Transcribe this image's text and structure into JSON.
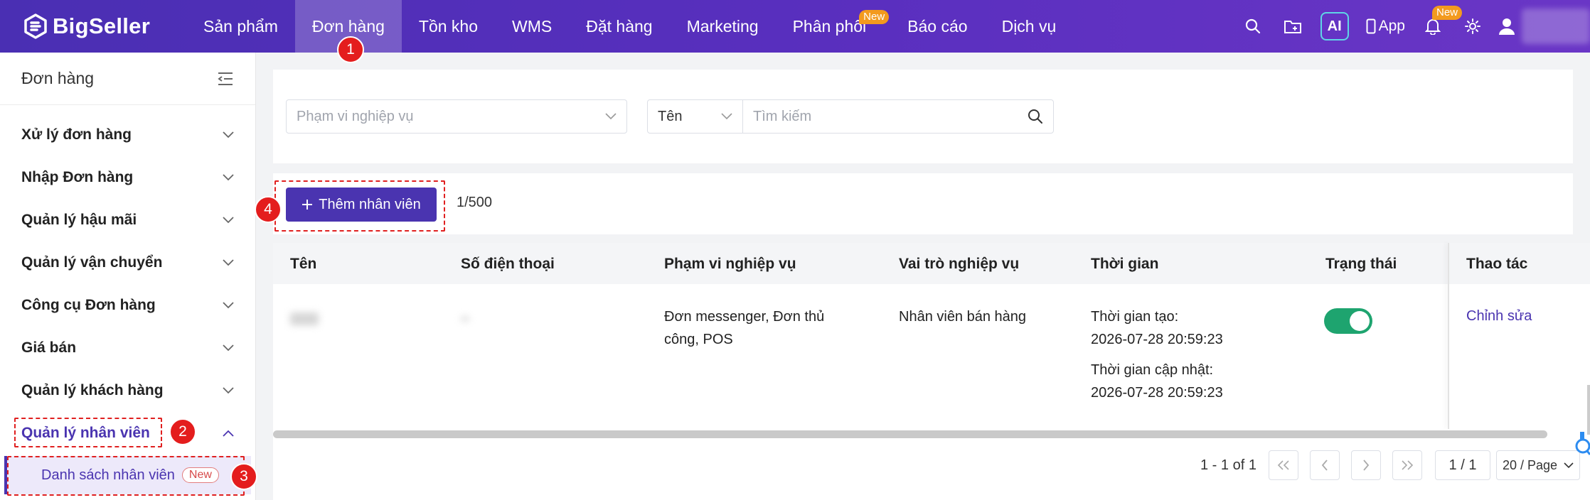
{
  "brand": {
    "name": "BigSeller"
  },
  "nav": {
    "items": [
      {
        "label": "Sản phẩm"
      },
      {
        "label": "Đơn hàng",
        "active": true
      },
      {
        "label": "Tồn kho"
      },
      {
        "label": "WMS"
      },
      {
        "label": "Đặt hàng"
      },
      {
        "label": "Marketing"
      },
      {
        "label": "Phân phối",
        "badge": "New"
      },
      {
        "label": "Báo cáo"
      },
      {
        "label": "Dịch vụ"
      }
    ],
    "right": {
      "ai_label": "AI",
      "app_label": "App",
      "bell_badge": "New"
    }
  },
  "sidebar": {
    "title": "Đơn hàng",
    "items": [
      {
        "label": "Xử lý đơn hàng"
      },
      {
        "label": "Nhập Đơn hàng"
      },
      {
        "label": "Quản lý hậu mãi"
      },
      {
        "label": "Quản lý vận chuyển"
      },
      {
        "label": "Công cụ Đơn hàng"
      },
      {
        "label": "Giá bán"
      },
      {
        "label": "Quản lý khách hàng"
      },
      {
        "label": "Quản lý nhân viên",
        "open": true
      }
    ],
    "sub_item": {
      "label": "Danh sách nhân viên",
      "badge": "New"
    }
  },
  "filters": {
    "scope_placeholder": "Phạm vi nghiệp vụ",
    "search_field": "Tên",
    "search_placeholder": "Tìm kiếm"
  },
  "actions": {
    "add_label": "Thêm nhân viên",
    "count": "1/500"
  },
  "table": {
    "columns": [
      "Tên",
      "Số điện thoại",
      "Phạm vi nghiệp vụ",
      "Vai trò nghiệp vụ",
      "Thời gian",
      "Trạng thái",
      "Thao tác"
    ],
    "rows": [
      {
        "scope_line1": "Đơn messenger, Đơn thủ",
        "scope_line2": "công, POS",
        "role": "Nhân viên bán hàng",
        "created_label": "Thời gian tạo:",
        "created_value": "2026-07-28 20:59:23",
        "updated_label": "Thời gian cập nhật:",
        "updated_value": "2026-07-28 20:59:23",
        "status_on": true,
        "action": "Chỉnh sửa"
      }
    ]
  },
  "pagination": {
    "total": "1 - 1 of 1",
    "page": "1 / 1",
    "page_size": "20 / Page"
  },
  "annotations": {
    "m1": "1",
    "m2": "2",
    "m3": "3",
    "m4": "4"
  },
  "colors": {
    "brand": "#4a34b0",
    "accent_badge": "#f39a1e",
    "toggle_on": "#1ea46f",
    "marker": "#e41d1d"
  }
}
